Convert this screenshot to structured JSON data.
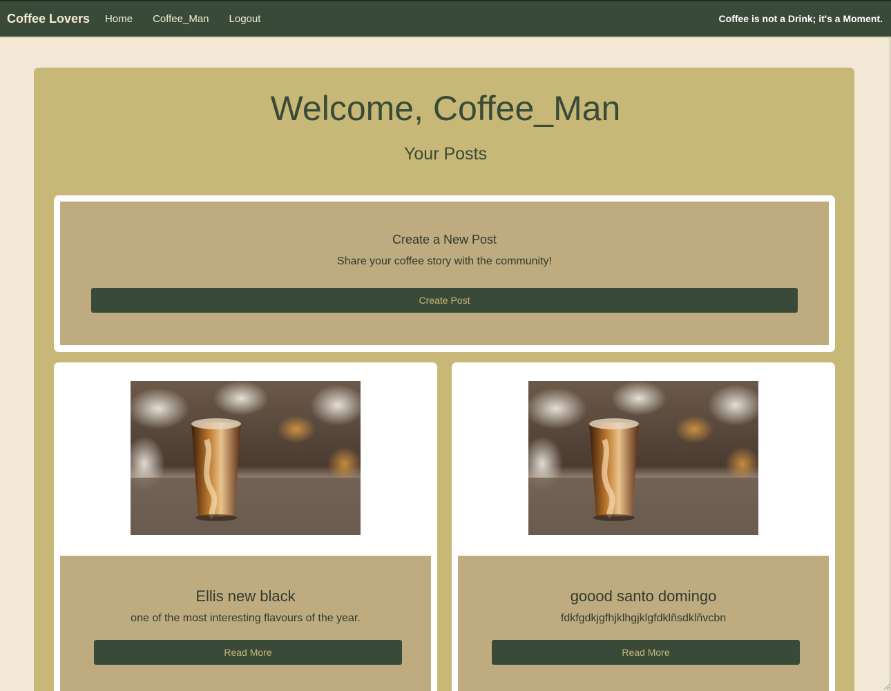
{
  "navbar": {
    "brand": "Coffee Lovers",
    "links": [
      "Home",
      "Coffee_Man",
      "Logout"
    ],
    "tagline": "Coffee is not a Drink; it's a Moment."
  },
  "header": {
    "welcome": "Welcome, Coffee_Man",
    "subtitle": "Your Posts"
  },
  "create_card": {
    "title": "Create a New Post",
    "description": "Share your coffee story with the community!",
    "button_label": "Create Post"
  },
  "posts": [
    {
      "title": "Ellis new black",
      "description": "one of the most interesting flavours of the year.",
      "button_label": "Read More",
      "image": "iced-coffee-photo"
    },
    {
      "title": "goood santo domingo",
      "description": "fdkfgdkjgfhjklhgjklgfdklñsdklñvcbn",
      "button_label": "Read More",
      "image": "iced-coffee-photo"
    }
  ],
  "colors": {
    "navbar": "#3a4a38",
    "page_bg": "#f2e8d5",
    "panel": "#c7b877",
    "card_inner": "#bfab80",
    "button": "#3a4a38",
    "button_text": "#c7b877"
  }
}
